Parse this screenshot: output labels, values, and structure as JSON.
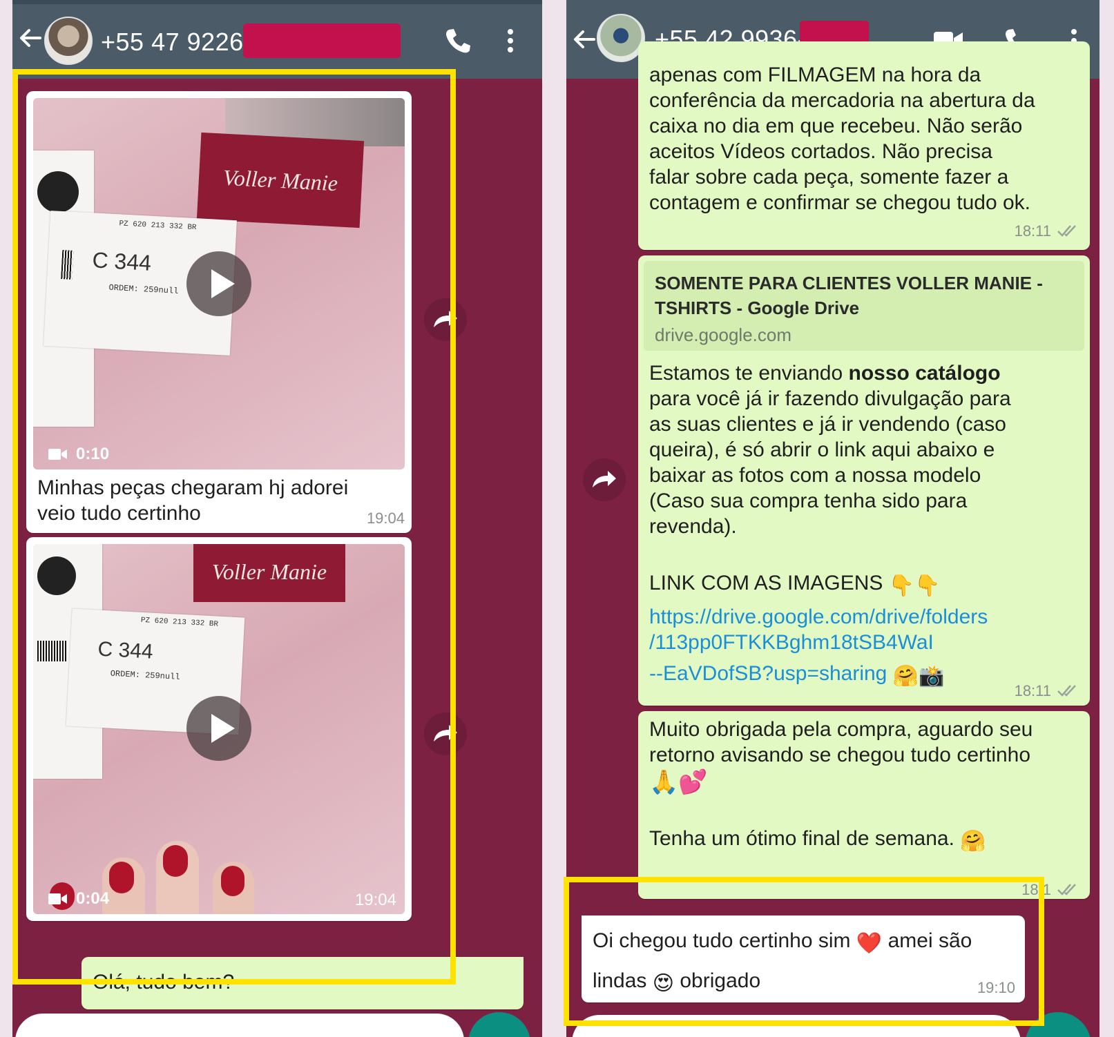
{
  "left_chat": {
    "contact": "+55 47 9226-",
    "messages": {
      "video1": {
        "duration": "0:10",
        "caption_line1": "Minhas peças chegaram hj adorei",
        "caption_line2": "veio tudo certinho",
        "time": "19:04"
      },
      "video2": {
        "duration": "0:04",
        "time": "19:04"
      },
      "sent_partial": "Olá, tudo bem?"
    },
    "label_text": {
      "code": "C 344",
      "ordem": "ORDEM: 259null",
      "pz": "PZ 620 213 332 BR"
    },
    "brand": "Voller Manie"
  },
  "right_chat": {
    "contact": "+55 42 9936-",
    "messages": {
      "msg1_lines": [
        "apenas com FILMAGEM na hora da",
        "conferência da mercadoria na abertura da",
        "caixa no dia em que recebeu. Não serão",
        "aceitos Vídeos cortados. Não precisa",
        "falar sobre cada peça, somente fazer a",
        "contagem e confirmar se chegou tudo ok."
      ],
      "msg1_time": "18:11",
      "preview_title_line1": "SOMENTE PARA CLIENTES VOLLER MANIE -",
      "preview_title_line2": "TSHIRTS - Google Drive",
      "preview_domain": "drive.google.com",
      "msg2_intro_a": "Estamos te enviando ",
      "msg2_intro_bold": "nosso catálogo",
      "msg2_lines": [
        "para você já ir fazendo divulgação para",
        "as suas clientes e já ir vendendo (caso",
        "queira), é só abrir o link aqui abaixo e",
        "baixar as fotos com a nossa modelo",
        "(Caso sua compra tenha sido para",
        "revenda)."
      ],
      "msg2_link_heading": "LINK COM AS IMAGENS",
      "msg2_link_heading_emoji": "👇👇",
      "msg2_url_line1": "https://drive.google.com/drive/folders",
      "msg2_url_line2": "/113pp0FTKKBghm18tSB4WaI",
      "msg2_url_line3": "--EaVDofSB?usp=sharing",
      "msg2_url_emoji": "🤗📸",
      "msg2_time": "18:11",
      "msg3_line1": "Muito obrigada pela compra, aguardo seu",
      "msg3_line2": "retorno avisando se chegou tudo certinho",
      "msg3_emoji": "🙏💕",
      "msg3_line3": "Tenha um ótimo final de semana.",
      "msg3_line3_emoji": "🤗",
      "msg3_time": "18:1",
      "reply_line1_a": "Oi chegou tudo certinho sim",
      "reply_line1_emoji": "❤️",
      "reply_line1_b": "amei são",
      "reply_line2_a": "lindas",
      "reply_line2_emoji": "😍",
      "reply_line2_b": "obrigado",
      "reply_time": "19:10"
    }
  },
  "colors": {
    "header": "#4b5c68",
    "chat_background": "#7d2143",
    "outgoing_bubble": "#e3f9c4",
    "incoming_bubble": "#ffffff",
    "highlight": "#ffe200",
    "redaction": "#c3114d",
    "link": "#1a8fd8"
  },
  "icons": [
    "back-arrow-icon",
    "phone-icon",
    "video-call-icon",
    "more-vert-icon",
    "play-icon",
    "video-camera-icon",
    "forward-icon",
    "double-check-icon",
    "mic-icon"
  ]
}
